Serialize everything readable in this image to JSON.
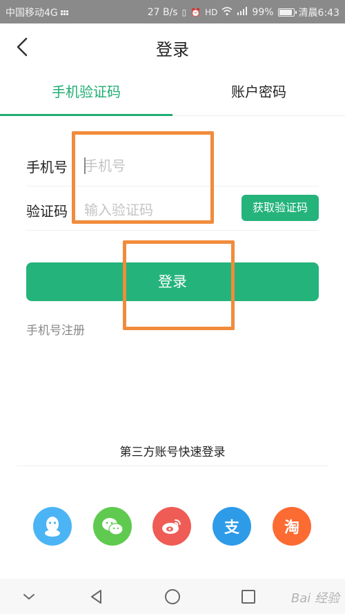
{
  "status_bar": {
    "carrier": "中国移动4G",
    "speed": "27 B/s",
    "battery": "99%",
    "battery_fraction": 0.99,
    "time": "清晨6:43"
  },
  "header": {
    "title": "登录"
  },
  "tabs": [
    {
      "label": "手机验证码",
      "active": true
    },
    {
      "label": "账户密码",
      "active": false
    }
  ],
  "form": {
    "phone_label": "手机号",
    "phone_placeholder": "手机号",
    "code_label": "验证码",
    "code_placeholder": "输入验证码",
    "get_code_button": "获取验证码",
    "login_button": "登录",
    "register_link": "手机号注册"
  },
  "third_party": {
    "title": "第三方账号快速登录",
    "icons": [
      {
        "name": "qq-icon",
        "color": "#4bb4f5"
      },
      {
        "name": "wechat-icon",
        "color": "#5fca4f"
      },
      {
        "name": "weibo-icon",
        "color": "#ef5b55"
      },
      {
        "name": "alipay-icon",
        "color": "#2d9be8",
        "glyph": "支"
      },
      {
        "name": "taobao-icon",
        "color": "#fb6b32",
        "glyph": "淘"
      }
    ]
  },
  "watermark": "Bai 经验",
  "colors": {
    "accent": "#24b37b",
    "annotation": "#f08c3c"
  }
}
